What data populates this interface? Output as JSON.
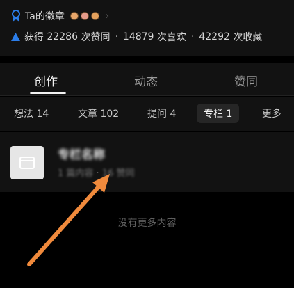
{
  "header": {
    "badge_label": "Ta的徽章",
    "chevron": "›",
    "stats_prefix": "获得",
    "stats": [
      {
        "count": "22286",
        "label": "次赞同"
      },
      {
        "count": "14879",
        "label": "次喜欢"
      },
      {
        "count": "42292",
        "label": "次收藏"
      }
    ],
    "separator": "·"
  },
  "tabs": [
    {
      "label": "创作",
      "active": true
    },
    {
      "label": "动态",
      "active": false
    },
    {
      "label": "赞同",
      "active": false
    }
  ],
  "subtabs": [
    {
      "label": "想法 14"
    },
    {
      "label": "文章 102"
    },
    {
      "label": "提问 4"
    },
    {
      "label": "专栏 1",
      "active": true
    },
    {
      "label": "更多"
    }
  ],
  "column_item": {
    "title": "专栏名称",
    "meta_count": "1 篇内容",
    "meta_sep": "·",
    "meta_likes": "16 赞同"
  },
  "empty_text": "没有更多内容",
  "colors": {
    "background": "#000000",
    "panel": "#121212",
    "accent_blue": "#2b7de9",
    "arrow_orange": "#f08a3c"
  },
  "icons": {
    "badge": "badge-ribbon-icon",
    "stats": "triangle-up-icon",
    "column": "column-card-icon"
  }
}
